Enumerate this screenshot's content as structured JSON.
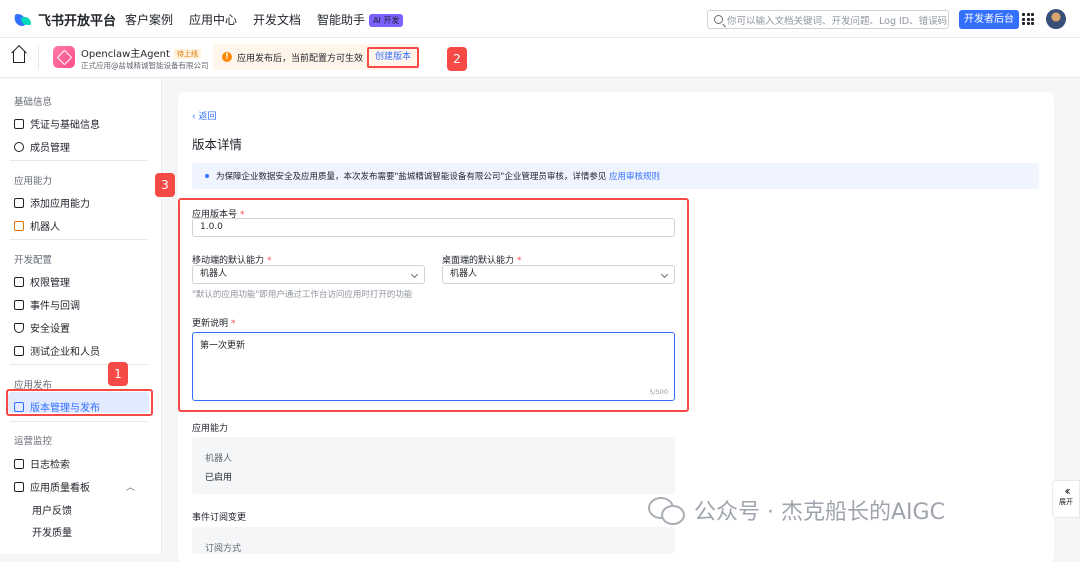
{
  "topnav": {
    "logo": "飞书开放平台",
    "items": [
      "客户案例",
      "应用中心",
      "开发文档",
      "智能助手"
    ],
    "ai_badge": "AI 开发",
    "search_placeholder": "你可以输入文档关键词、开发问题、Log ID、错误码",
    "dev_console": "开发者后台"
  },
  "subbar": {
    "app_name": "Openclaw主Agent",
    "app_tag": "待上线",
    "app_sub": "正式应用@盐城精诚智能设备有限公司",
    "notice": "应用发布后，当前配置方可生效",
    "create_version": "创建版本"
  },
  "markers": [
    "1",
    "2",
    "3"
  ],
  "sidebar": {
    "groups": [
      {
        "title": "基础信息",
        "items": [
          "凭证与基础信息",
          "成员管理"
        ]
      },
      {
        "title": "应用能力",
        "items": [
          "添加应用能力",
          "机器人"
        ]
      },
      {
        "title": "开发配置",
        "items": [
          "权限管理",
          "事件与回调",
          "安全设置",
          "测试企业和人员"
        ]
      },
      {
        "title": "应用发布",
        "items": [
          "版本管理与发布"
        ]
      },
      {
        "title": "运营监控",
        "items": [
          "日志检索",
          "应用质量看板",
          "用户反馈",
          "开发质量"
        ]
      }
    ]
  },
  "main": {
    "back": "返回",
    "title": "版本详情",
    "info": "为保障企业数据安全及应用质量，本次发布需要\"盐城精诚智能设备有限公司\"企业管理员审核，详情参见",
    "info_link": "应用审核规则",
    "version_label": "应用版本号",
    "version_value": "1.0.0",
    "mobile_label": "移动端的默认能力",
    "mobile_value": "机器人",
    "desktop_label": "桌面端的默认能力",
    "desktop_value": "机器人",
    "hint": "\"默认的应用功能\"即用户通过工作台访问应用时打开的功能",
    "notes_label": "更新说明",
    "notes_value": "第一次更新",
    "notes_counter": "5/500",
    "capability_title": "应用能力",
    "capability_name": "机器人",
    "capability_status": "已启用",
    "event_title": "事件订阅变更",
    "event_label": "订阅方式"
  },
  "expand": "展开",
  "watermark": "公众号 · 杰克船长的AIGC",
  "colors": {
    "accent": "#3370ff",
    "annotation": "#f54a45",
    "warning": "#ff8800"
  }
}
